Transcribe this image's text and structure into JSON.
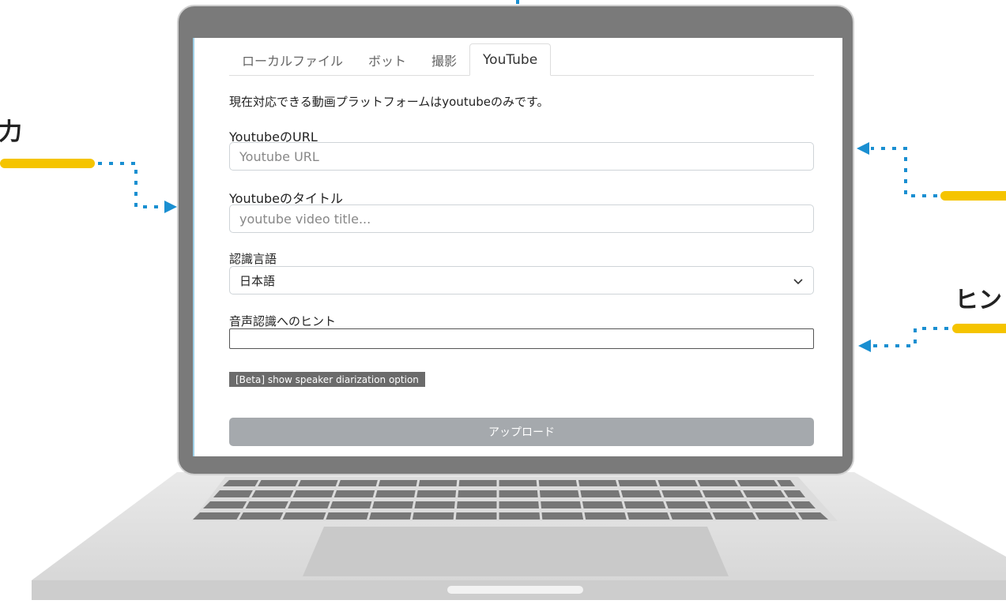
{
  "callouts": {
    "left_text": "力",
    "right_text": "ヒン"
  },
  "tabs": [
    {
      "label": "ローカルファイル",
      "active": false
    },
    {
      "label": "ボット",
      "active": false
    },
    {
      "label": "撮影",
      "active": false
    },
    {
      "label": "YouTube",
      "active": true
    }
  ],
  "form": {
    "info": "現在対応できる動画プラットフォームはyoutubeのみです。",
    "url_label": "YoutubeのURL",
    "url_placeholder": "Youtube URL",
    "title_label": "Youtubeのタイトル",
    "title_placeholder": "youtube video title...",
    "language_label": "認識言語",
    "language_value": "日本語",
    "hint_label": "音声認識へのヒント",
    "hint_value": "",
    "beta_label": "[Beta] show speaker diarization option",
    "upload_label": "アップロード"
  },
  "colors": {
    "accent_yellow": "#f5c400",
    "arrow_blue": "#1a8fd1",
    "upload_button": "#a5a9ad"
  }
}
